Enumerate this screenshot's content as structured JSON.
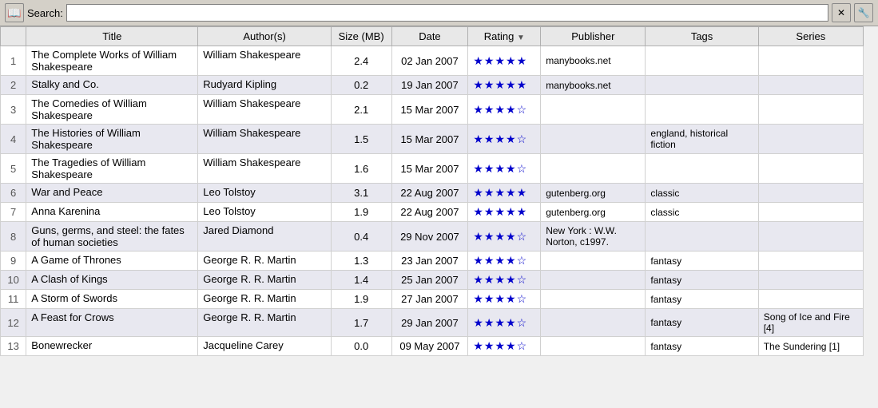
{
  "search": {
    "label": "Search:",
    "placeholder": "",
    "value": ""
  },
  "table": {
    "columns": [
      {
        "key": "num",
        "label": "",
        "sortable": false
      },
      {
        "key": "title",
        "label": "Title",
        "sortable": false
      },
      {
        "key": "authors",
        "label": "Author(s)",
        "sortable": false
      },
      {
        "key": "size",
        "label": "Size (MB)",
        "sortable": false
      },
      {
        "key": "date",
        "label": "Date",
        "sortable": false
      },
      {
        "key": "rating",
        "label": "Rating",
        "sortable": true
      },
      {
        "key": "publisher",
        "label": "Publisher",
        "sortable": false
      },
      {
        "key": "tags",
        "label": "Tags",
        "sortable": false
      },
      {
        "key": "series",
        "label": "Series",
        "sortable": false
      }
    ],
    "rows": [
      {
        "num": "1",
        "title": "The Complete Works of William Shakespeare",
        "authors": "William Shakespeare",
        "size": "2.4",
        "date": "02 Jan 2007",
        "rating": 5,
        "publisher": "manybooks.net",
        "tags": "",
        "series": ""
      },
      {
        "num": "2",
        "title": "Stalky and Co.",
        "authors": "Rudyard Kipling",
        "size": "0.2",
        "date": "19 Jan 2007",
        "rating": 5,
        "publisher": "manybooks.net",
        "tags": "",
        "series": ""
      },
      {
        "num": "3",
        "title": "The Comedies of William Shakespeare",
        "authors": "William Shakespeare",
        "size": "2.1",
        "date": "15 Mar 2007",
        "rating": 4,
        "publisher": "",
        "tags": "",
        "series": ""
      },
      {
        "num": "4",
        "title": "The Histories of William Shakespeare",
        "authors": "William Shakespeare",
        "size": "1.5",
        "date": "15 Mar 2007",
        "rating": 4,
        "publisher": "",
        "tags": "england, historical fiction",
        "series": ""
      },
      {
        "num": "5",
        "title": "The Tragedies of William Shakespeare",
        "authors": "William Shakespeare",
        "size": "1.6",
        "date": "15 Mar 2007",
        "rating": 4,
        "publisher": "",
        "tags": "",
        "series": ""
      },
      {
        "num": "6",
        "title": "War and Peace",
        "authors": "Leo Tolstoy",
        "size": "3.1",
        "date": "22 Aug 2007",
        "rating": 5,
        "publisher": "gutenberg.org",
        "tags": "classic",
        "series": ""
      },
      {
        "num": "7",
        "title": "Anna Karenina",
        "authors": "Leo Tolstoy",
        "size": "1.9",
        "date": "22 Aug 2007",
        "rating": 5,
        "publisher": "gutenberg.org",
        "tags": "classic",
        "series": ""
      },
      {
        "num": "8",
        "title": "Guns, germs, and steel: the fates of human societies",
        "authors": "Jared Diamond",
        "size": "0.4",
        "date": "29 Nov 2007",
        "rating": 4,
        "publisher": "New York : W.W. Norton, c1997.",
        "tags": "",
        "series": ""
      },
      {
        "num": "9",
        "title": "A Game of Thrones",
        "authors": "George R. R. Martin",
        "size": "1.3",
        "date": "23 Jan 2007",
        "rating": 4,
        "publisher": "",
        "tags": "fantasy",
        "series": ""
      },
      {
        "num": "10",
        "title": "A Clash of Kings",
        "authors": "George R. R. Martin",
        "size": "1.4",
        "date": "25 Jan 2007",
        "rating": 4,
        "publisher": "",
        "tags": "fantasy",
        "series": ""
      },
      {
        "num": "11",
        "title": "A Storm of Swords",
        "authors": "George R. R. Martin",
        "size": "1.9",
        "date": "27 Jan 2007",
        "rating": 4,
        "publisher": "",
        "tags": "fantasy",
        "series": ""
      },
      {
        "num": "12",
        "title": "A Feast for Crows",
        "authors": "George R. R. Martin",
        "size": "1.7",
        "date": "29 Jan 2007",
        "rating": 4,
        "publisher": "",
        "tags": "fantasy",
        "series": "Song of Ice and Fire [4]"
      },
      {
        "num": "13",
        "title": "Bonewrecker",
        "authors": "Jacqueline Carey",
        "size": "0.0",
        "date": "09 May 2007",
        "rating": 4,
        "publisher": "",
        "tags": "fantasy",
        "series": "The Sundering [1]"
      }
    ]
  },
  "icons": {
    "search": "🔍",
    "clear": "✕",
    "settings": "🔧",
    "sort_asc": "▼"
  }
}
